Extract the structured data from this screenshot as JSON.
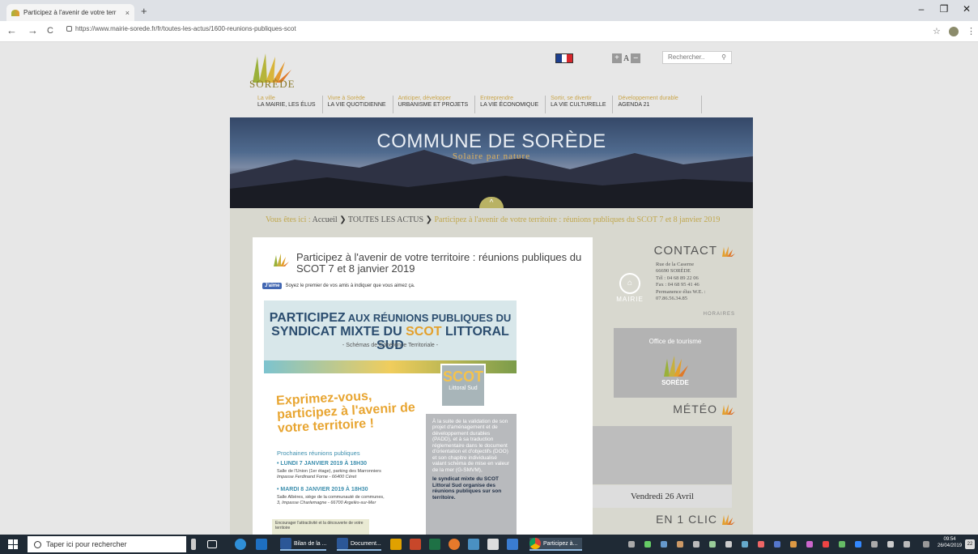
{
  "browser": {
    "tab_title": "Participez à l'avenir de votre terr",
    "tab_close": "×",
    "new_tab": "+",
    "url": "https://www.mairie-sorede.fr/fr/toutes-les-actus/1600-reunions-publiques-scot",
    "win_min": "–",
    "win_max": "❐",
    "win_close": "✕",
    "back": "←",
    "forward": "→",
    "reload": "C",
    "star": "☆",
    "menu": "⋮"
  },
  "site": {
    "logo_text": "SORÈDE",
    "search_placeholder": "Rechercher..",
    "search_icon": "🔍",
    "font_plus": "+",
    "font_a": "A",
    "font_minus": "–",
    "menu": [
      {
        "small": "La ville",
        "main": "LA MAIRIE, LES ÉLUS"
      },
      {
        "small": "Vivre à Sorède",
        "main": "LA VIE QUOTIDIENNE"
      },
      {
        "small": "Anticiper, développer",
        "main": "URBANISME ET PROJETS"
      },
      {
        "small": "Entreprendre",
        "main": "LA VIE ÉCONOMIQUE"
      },
      {
        "small": "Sortir, se divertir",
        "main": "LA VIE CULTURELLE"
      },
      {
        "small": "Développement durable",
        "main": "AGENDA 21"
      }
    ],
    "banner_title": "COMMUNE DE SORÈDE",
    "banner_subtitle": "Solaire par nature",
    "chevron": "^",
    "breadcrumb": {
      "prefix": "Vous êtes ici :",
      "home": "Accueil",
      "sep": "❯",
      "section": "TOUTES LES ACTUS",
      "current": "Participez à l'avenir de votre territoire : réunions publiques du SCOT 7 et 8 janvier 2019"
    }
  },
  "article": {
    "title": "Participez à l'avenir de votre territoire : réunions publiques du SCOT 7 et 8 janvier 2019",
    "fb_button": "J'aime",
    "fb_text": "Soyez le premier de vos amis à indiquer que vous aimez ça.",
    "poster": {
      "h1_a": "PARTICIPEZ",
      "h1_b": " AUX RÉUNIONS PUBLIQUES DU",
      "h1_c": "SYNDICAT MIXTE DU ",
      "h1_d": "SCOT",
      "h1_e": " LITTORAL SUD",
      "h2": "- Schémas de Cohérence Territoriale -",
      "scot": "SCOT",
      "scot_sub": "Littoral Sud",
      "exprimez": "Exprimez-vous, participez à l'avenir de votre territoire !",
      "next": "Prochaines réunions publiques",
      "ev1": "• LUNDI 7 JANVIER 2019 À 18H30",
      "ev1_d1": "Salle de l'Union (1er étage), parking des Marronniers",
      "ev1_d2": "Impasse Ferdinand Forne - 66400 Céret",
      "ev2": "• MARDI 8 JANVIER 2019 À 18H30",
      "ev2_d1": "Salle Albères, siège de la communauté de communes,",
      "ev2_d2": "3, Impasse Charlemagne - 66700 Argelès-sur-Mer",
      "gray_text": "À la suite de la validation de son projet d'aménagement et de développement durables (PADD), et à sa traduction réglementaire dans le document d'orientation et d'objectifs (DOO) et son chapitre individualisé valant schéma de mise en valeur de la mer (G-SMVM),",
      "gray_bold": "le syndicat mixte du SCOT Littoral Sud organise des réunions publiques sur son territoire.",
      "strip": "Encourager l'attractivité et la découverte de votre territoire"
    }
  },
  "sidebar": {
    "contact_title": "CONTACT",
    "mairie_label": "MAIRIE",
    "address": [
      "Rue de la Caserne",
      "66690 SORÈDE",
      "Tél : 04 68 89 22 06",
      "Fax : 04 68 95 41 46",
      "Permanence élus W.E. :",
      "07.86.56.34.85"
    ],
    "horaires": "HORAIRES",
    "tourism_title": "Office de tourisme",
    "tourism_logo": "SORÈDE",
    "meteo_title": "MÉTÉO",
    "date": "Vendredi 26 Avril",
    "clic_title": "EN 1 CLIC"
  },
  "taskbar": {
    "search_text": "Taper ici pour rechercher",
    "items": [
      {
        "label": "Bilan de la ..."
      },
      {
        "label": "Document..."
      },
      {
        "label": "Participez à..."
      }
    ],
    "time": "09:54",
    "date": "26/04/2019",
    "notif": "22"
  },
  "colors": {
    "accent_gold": "#c0a74c",
    "banner_dark": "#1d1f28",
    "taskbar": "#1f2a35"
  }
}
